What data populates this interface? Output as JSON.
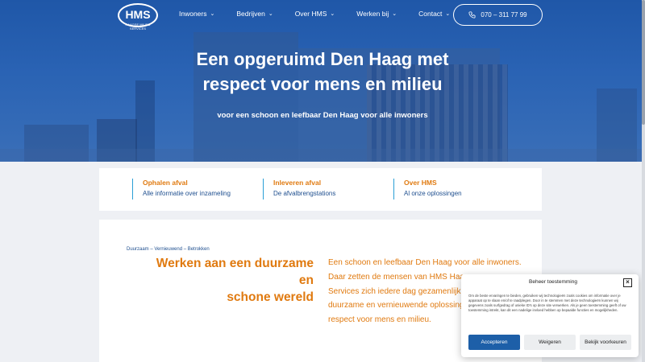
{
  "header": {
    "logo_text": "HMS",
    "logo_tagline": "HAAGSE MILIEU SERVICES",
    "nav": [
      {
        "label": "Inwoners"
      },
      {
        "label": "Bedrijven"
      },
      {
        "label": "Over HMS"
      },
      {
        "label": "Werken bij"
      },
      {
        "label": "Contact"
      }
    ],
    "phone": "070 – 311 77 99"
  },
  "hero": {
    "title_line1": "Een opgeruimd Den Haag met",
    "title_line2": "respect voor mens en milieu",
    "subtitle": "voor een schoon en leefbaar Den Haag voor alle inwoners"
  },
  "quick_links": [
    {
      "title": "Ophalen afval",
      "desc": "Alle informatie over inzameling"
    },
    {
      "title": "Inleveren afval",
      "desc": "De afvalbrengstations"
    },
    {
      "title": "Over HMS",
      "desc": "Al onze oplossingen"
    }
  ],
  "content": {
    "breadcrumb": "Duurzaam – Vernieuwend – Betrokken",
    "heading_line1": "Werken aan een duurzame en",
    "heading_line2": "schone wereld",
    "body_lines": [
      "Een schoon en leefbaar Den Haag voor alle inwoners.",
      "Daar zetten de mensen van HMS Haagse",
      "Services zich iedere dag gezamenlijk voor",
      "duurzame en vernieuwende oplossingen",
      "respect voor mens en milieu."
    ]
  },
  "cookie": {
    "title": "Beheer toestemming",
    "text": "Om de beste ervaringen te bieden, gebruiken wij technologieën zoals cookies om informatie over je apparaat op te slaan en/of te raadplegen. Door in te stemmen met deze technologieën kunnen wij gegevens zoals surfgedrag of unieke ID's op deze site verwerken. Als je geen toestemming geeft of uw toestemming intrekt, kan dit een nadelige invloed hebben op bepaalde functies en mogelijkheden.",
    "accept": "Accepteren",
    "deny": "Weigeren",
    "prefs": "Bekijk voorkeuren"
  },
  "colors": {
    "brand_blue": "#1f57a8",
    "accent_orange": "#e07a10",
    "link_blue": "#1f4f8f"
  }
}
